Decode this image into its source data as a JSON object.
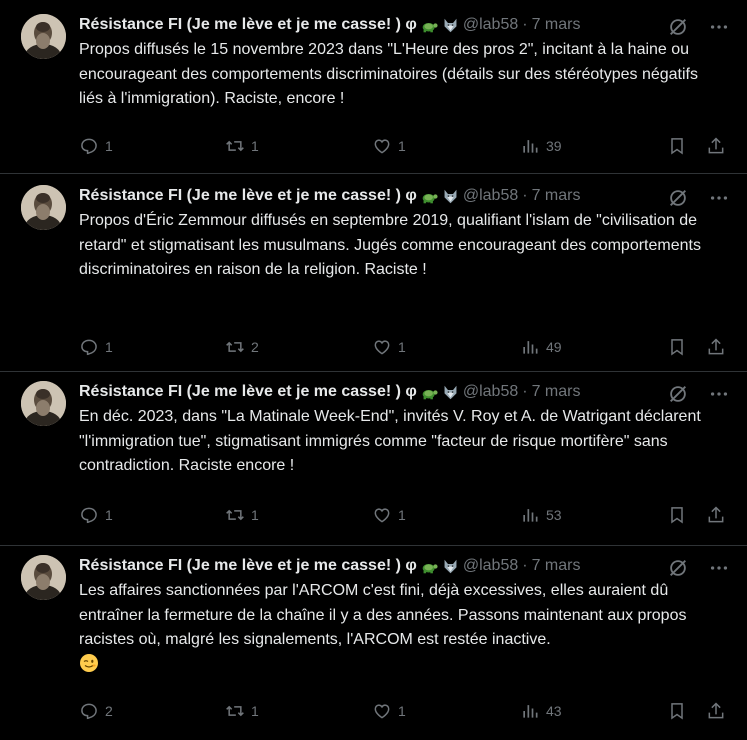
{
  "tweets": [
    {
      "display_name": "Résistance FI (Je me lève et je me casse! ) φ",
      "handle": "@lab58",
      "dot": "·",
      "time": "7 mars",
      "text": "Propos diffusés le 15 novembre 2023 dans \"L'Heure des pros 2\", incitant à la haine ou encourageant des comportements discriminatoires (détails sur des stéréotypes négatifs liés à l'immigration). Raciste, encore !",
      "replies": "1",
      "retweets": "1",
      "likes": "1",
      "views": "39"
    },
    {
      "display_name": "Résistance FI (Je me lève et je me casse! ) φ",
      "handle": "@lab58",
      "dot": "·",
      "time": "7 mars",
      "text": "Propos d'Éric Zemmour diffusés en septembre 2019, qualifiant l'islam de \"civilisation de retard\" et stigmatisant les musulmans. Jugés comme encourageant des comportements discriminatoires en raison de la religion. Raciste !",
      "replies": "1",
      "retweets": "2",
      "likes": "1",
      "views": "49"
    },
    {
      "display_name": "Résistance FI (Je me lève et je me casse! ) φ",
      "handle": "@lab58",
      "dot": "·",
      "time": "7 mars",
      "text": "En déc. 2023, dans \"La Matinale Week-End\", invités V. Roy et A. de Watrigant déclarent \"l'immigration tue\", stigmatisant immigrés comme \"facteur de risque mortifère\" sans contradiction. Raciste encore !",
      "replies": "1",
      "retweets": "1",
      "likes": "1",
      "views": "53"
    },
    {
      "display_name": "Résistance FI (Je me lève et je me casse! ) φ",
      "handle": "@lab58",
      "dot": "·",
      "time": "7 mars",
      "text": "Les affaires sanctionnées par l'ARCOM c'est fini, déjà excessives, elles auraient dû entraîner la fermeture de la chaîne il y a des années. Passons maintenant aux propos racistes où, malgré les signalements, l'ARCOM est restée inactive.",
      "replies": "2",
      "retweets": "1",
      "likes": "1",
      "views": "43"
    }
  ],
  "icons": {
    "turtle": "turtle-emoji",
    "wolf": "wolf-emoji",
    "grok": "grok-icon",
    "more": "more-icon",
    "reply": "reply-icon",
    "retweet": "retweet-icon",
    "like": "like-icon",
    "views": "views-icon",
    "bookmark": "bookmark-icon",
    "share": "share-icon",
    "wink": "winking-face-emoji"
  },
  "colors": {
    "background": "#000000",
    "text": "#e7e9ea",
    "secondary": "#71767b",
    "divider": "#2f3336"
  }
}
